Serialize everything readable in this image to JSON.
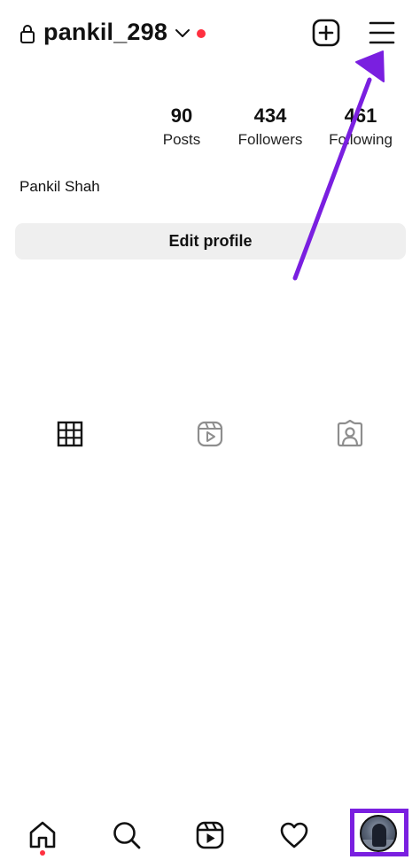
{
  "header": {
    "username": "pankil_298",
    "lock_icon": "lock-icon",
    "chevron_icon": "chevron-down-icon",
    "create_icon": "plus-square-icon",
    "menu_icon": "hamburger-menu-icon"
  },
  "stats": {
    "posts": {
      "value": "90",
      "label": "Posts"
    },
    "followers": {
      "value": "434",
      "label": "Followers"
    },
    "following": {
      "value": "461",
      "label": "Following"
    }
  },
  "profile": {
    "full_name": "Pankil Shah",
    "edit_button": "Edit profile"
  },
  "tabs": [
    {
      "name": "posts",
      "icon": "grid-icon",
      "active": true
    },
    {
      "name": "reels",
      "icon": "reels-icon",
      "active": false
    },
    {
      "name": "tagged",
      "icon": "tagged-person-icon",
      "active": false
    }
  ],
  "bottom_nav": [
    {
      "name": "home",
      "icon": "home-icon"
    },
    {
      "name": "search",
      "icon": "search-icon"
    },
    {
      "name": "reels",
      "icon": "reels-icon"
    },
    {
      "name": "activity",
      "icon": "heart-icon"
    },
    {
      "name": "profile",
      "icon": "avatar"
    }
  ],
  "colors": {
    "notification_dot": "#ff3040",
    "annotation_purple": "#7a1fe0",
    "button_bg": "#efefef"
  }
}
